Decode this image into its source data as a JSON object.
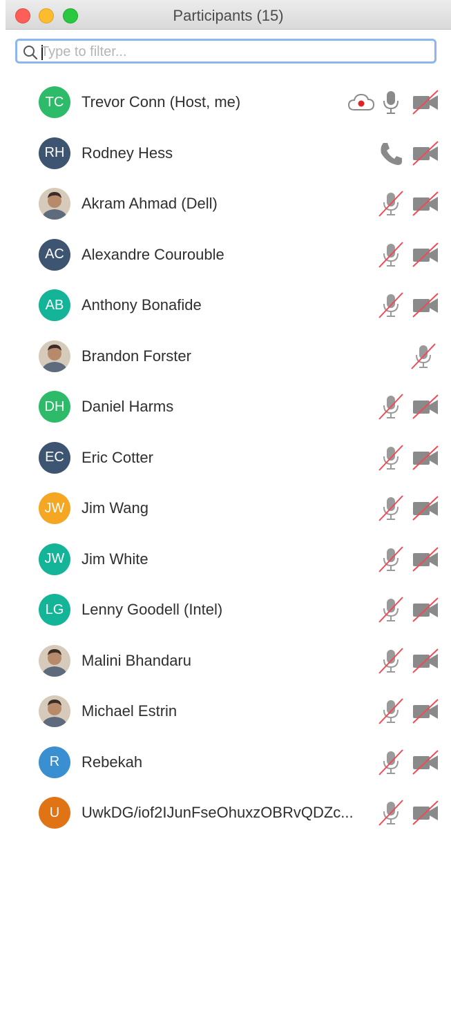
{
  "window": {
    "title": "Participants (15)"
  },
  "search": {
    "placeholder": "Type to filter...",
    "value": ""
  },
  "colors": {
    "green": "#2dbb6a",
    "navy": "#3d5570",
    "teal": "#13b497",
    "orange_yellow": "#f5a623",
    "blue": "#3a8fd1",
    "dark_orange": "#e07314",
    "muted_red": "#ef4b55"
  },
  "participants": [
    {
      "initials": "TC",
      "name": "Trevor Conn (Host, me)",
      "avatar_color": "#2dbb6a",
      "avatar_type": "initials",
      "recording": true,
      "mic": "on",
      "video": "off"
    },
    {
      "initials": "RH",
      "name": "Rodney Hess",
      "avatar_color": "#3d5570",
      "avatar_type": "initials",
      "audio": "phone",
      "video": "off"
    },
    {
      "initials": "",
      "name": "Akram Ahmad (Dell)",
      "avatar_type": "photo",
      "mic": "muted",
      "video": "off"
    },
    {
      "initials": "AC",
      "name": "Alexandre Courouble",
      "avatar_color": "#3d5570",
      "avatar_type": "initials",
      "mic": "muted",
      "video": "off"
    },
    {
      "initials": "AB",
      "name": "Anthony Bonafide",
      "avatar_color": "#13b497",
      "avatar_type": "initials",
      "mic": "muted",
      "video": "off"
    },
    {
      "initials": "",
      "name": "Brandon Forster",
      "avatar_type": "photo",
      "mic": "muted",
      "video": "none"
    },
    {
      "initials": "DH",
      "name": "Daniel Harms",
      "avatar_color": "#2dbb6a",
      "avatar_type": "initials",
      "mic": "muted",
      "video": "off"
    },
    {
      "initials": "EC",
      "name": "Eric Cotter",
      "avatar_color": "#3d5570",
      "avatar_type": "initials",
      "mic": "muted",
      "video": "off"
    },
    {
      "initials": "JW",
      "name": "Jim Wang",
      "avatar_color": "#f5a623",
      "avatar_type": "initials",
      "mic": "muted",
      "video": "off"
    },
    {
      "initials": "JW",
      "name": "Jim White",
      "avatar_color": "#13b497",
      "avatar_type": "initials",
      "mic": "muted",
      "video": "off"
    },
    {
      "initials": "LG",
      "name": "Lenny Goodell (Intel)",
      "avatar_color": "#13b497",
      "avatar_type": "initials",
      "mic": "muted",
      "video": "off"
    },
    {
      "initials": "",
      "name": "Malini Bhandaru",
      "avatar_type": "photo",
      "mic": "muted",
      "video": "off"
    },
    {
      "initials": "",
      "name": "Michael Estrin",
      "avatar_type": "photo",
      "mic": "muted",
      "video": "off"
    },
    {
      "initials": "R",
      "name": "Rebekah",
      "avatar_color": "#3a8fd1",
      "avatar_type": "initials",
      "mic": "muted",
      "video": "off"
    },
    {
      "initials": "U",
      "name": "UwkDG/iof2IJunFseOhuxzOBRvQDZc...",
      "avatar_color": "#e07314",
      "avatar_type": "initials",
      "mic": "muted",
      "video": "off"
    }
  ]
}
